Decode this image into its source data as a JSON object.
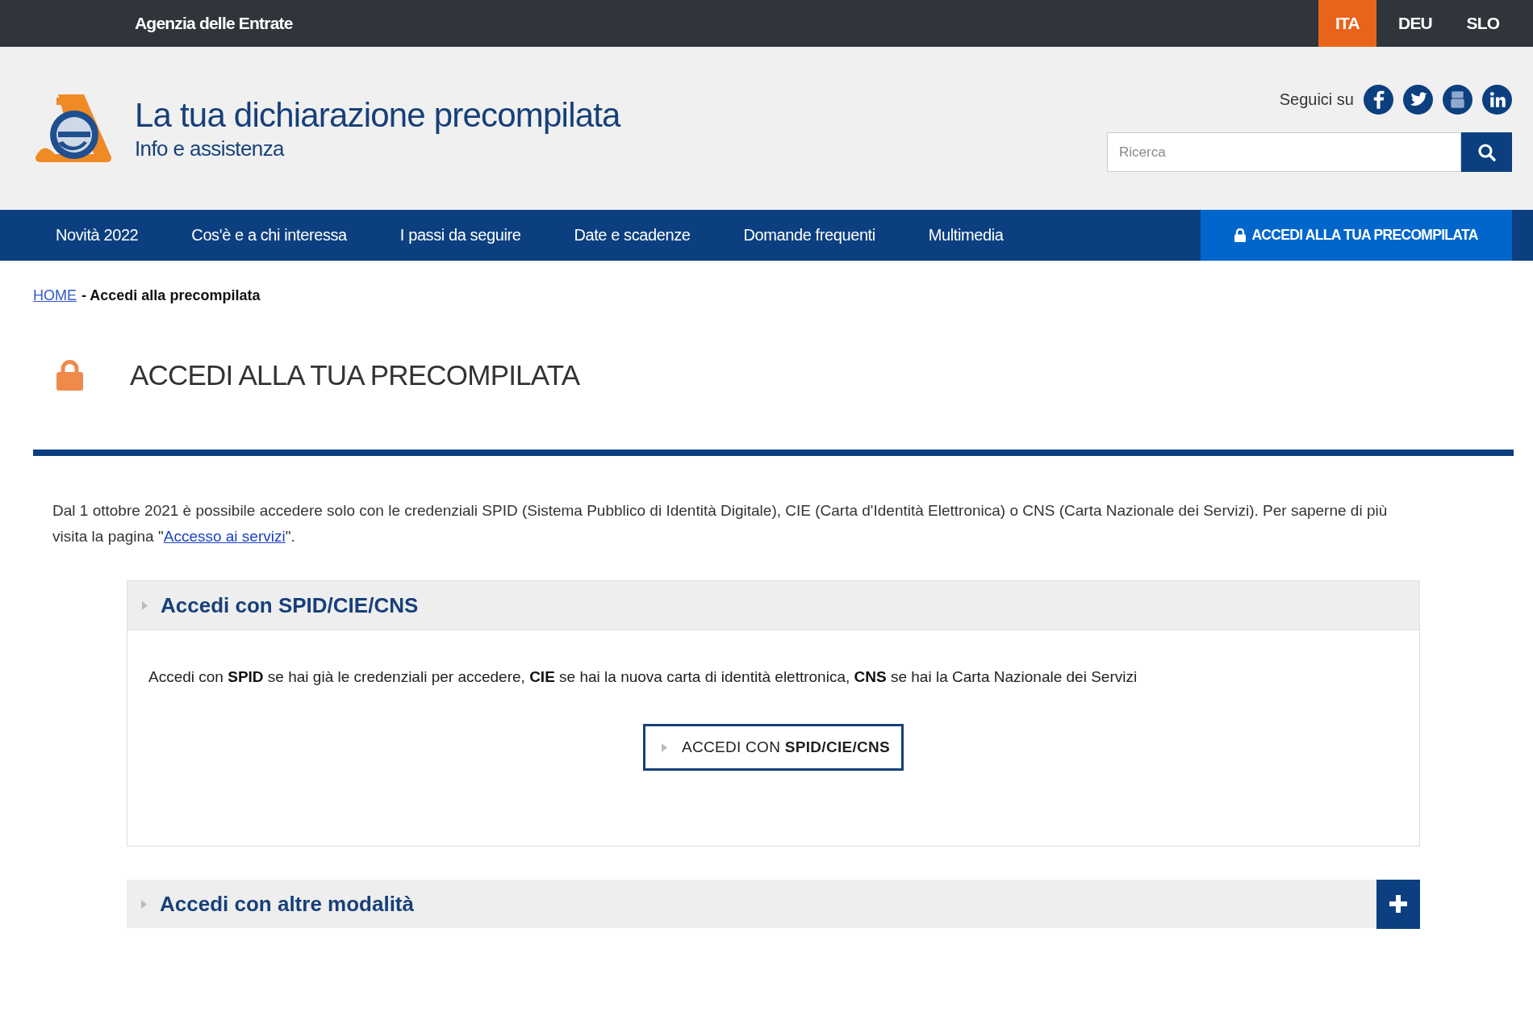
{
  "topbar": {
    "agency": "Agenzia delle Entrate",
    "languages": [
      {
        "label": "ITA",
        "selected": true
      },
      {
        "label": "DEU",
        "selected": false
      },
      {
        "label": "SLO",
        "selected": false
      }
    ]
  },
  "header": {
    "title": "La tua dichiarazione precompilata",
    "subtitle": "Info e assistenza",
    "follow_label": "Seguici su",
    "search": {
      "placeholder": "Ricerca"
    }
  },
  "nav": {
    "items": [
      "Novità 2022",
      "Cos'è e a chi interessa",
      "I passi da seguire",
      "Date e scadenze",
      "Domande frequenti",
      "Multimedia"
    ],
    "cta": "ACCEDI ALLA TUA PRECOMPILATA"
  },
  "breadcrumb": {
    "home": "HOME",
    "current": "- Accedi alla precompilata"
  },
  "page_title": "ACCEDI ALLA TUA PRECOMPILATA",
  "intro": {
    "text_before": "Dal 1 ottobre 2021 è possibile accedere solo con le credenziali SPID (Sistema Pubblico di Identità Digitale), CIE (Carta d'Identità Elettronica) o CNS (Carta Nazionale dei Servizi). Per saperne di più visita la pagina \"",
    "link": "Accesso ai servizi",
    "text_after": "\"."
  },
  "accordions": [
    {
      "title": "Accedi con SPID/CIE/CNS",
      "expanded": true,
      "body": "Accedi con **SPID** se hai già le credenziali per accedere, **CIE** se hai la nuova carta di identità elettronica, **CNS** se hai la Carta Nazionale dei Servizi",
      "button": "ACCEDI CON **SPID/CIE/CNS**"
    },
    {
      "title": "Accedi con altre modalità",
      "expanded": false
    }
  ]
}
